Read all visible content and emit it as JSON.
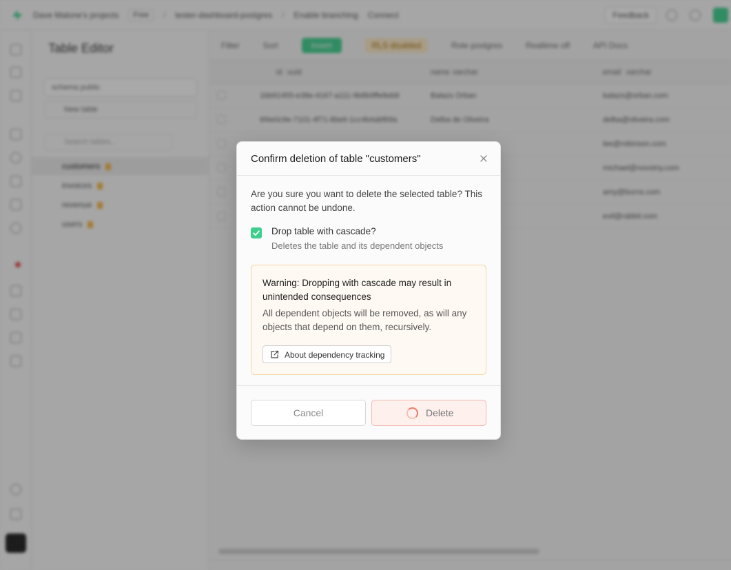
{
  "topbar": {
    "org": "Dave Malone's projects",
    "plan": "Free",
    "project": "tester-dashboard-postgres",
    "branch": "Enable branching",
    "connect": "Connect",
    "feedback": "Feedback"
  },
  "sidebar": {
    "title": "Table Editor",
    "schema_label": "schema public",
    "new_table": "New table",
    "search_placeholder": "Search tables...",
    "tables": [
      {
        "name": "customers"
      },
      {
        "name": "invoices"
      },
      {
        "name": "revenue"
      },
      {
        "name": "users"
      }
    ]
  },
  "grid": {
    "toolbar": {
      "filter": "Filter",
      "sort": "Sort",
      "insert": "Insert",
      "rls": "RLS disabled",
      "role": "Role postgres",
      "realtime": "Realtime off",
      "api_docs": "API Docs"
    },
    "columns": [
      {
        "name": "id",
        "type": "uuid"
      },
      {
        "name": "name",
        "type": "varchar"
      },
      {
        "name": "email",
        "type": "varchar"
      }
    ],
    "rows": [
      {
        "id": "1bb91455-e38e-4167-a111-9b8b9ffe8eb8",
        "name": "Balazs Orban",
        "email": "balazs@orban.com"
      },
      {
        "id": "6f4e0c9e-7101-4f71-8be6-1cc4b4abf69a",
        "name": "Delba de Oliveira",
        "email": "delba@oliveira.com"
      },
      {
        "id": "",
        "name": "",
        "email": "lee@robinson.com"
      },
      {
        "id": "",
        "name": "",
        "email": "michael@novotny.com"
      },
      {
        "id": "",
        "name": "",
        "email": "amy@burns.com"
      },
      {
        "id": "",
        "name": "",
        "email": "evil@rabbit.com"
      }
    ]
  },
  "modal": {
    "title": "Confirm deletion of table \"customers\"",
    "question": "Are you sure you want to delete the selected table? This action cannot be undone.",
    "cascade_label": "Drop table with cascade?",
    "cascade_description": "Deletes the table and its dependent objects",
    "cascade_checked": true,
    "warning_title": "Warning: Dropping with cascade may result in unintended consequences",
    "warning_body": "All dependent objects will be removed, as will any objects that depend on them, recursively.",
    "warning_link": "About dependency tracking",
    "cancel_label": "Cancel",
    "delete_label": "Delete",
    "colors": {
      "accent": "#3ecf8e",
      "warning_bg": "#fefaf3",
      "warning_border": "#f3d8a6",
      "danger_border": "#f2b9b2",
      "danger_spinner": "#ea7b67"
    }
  }
}
